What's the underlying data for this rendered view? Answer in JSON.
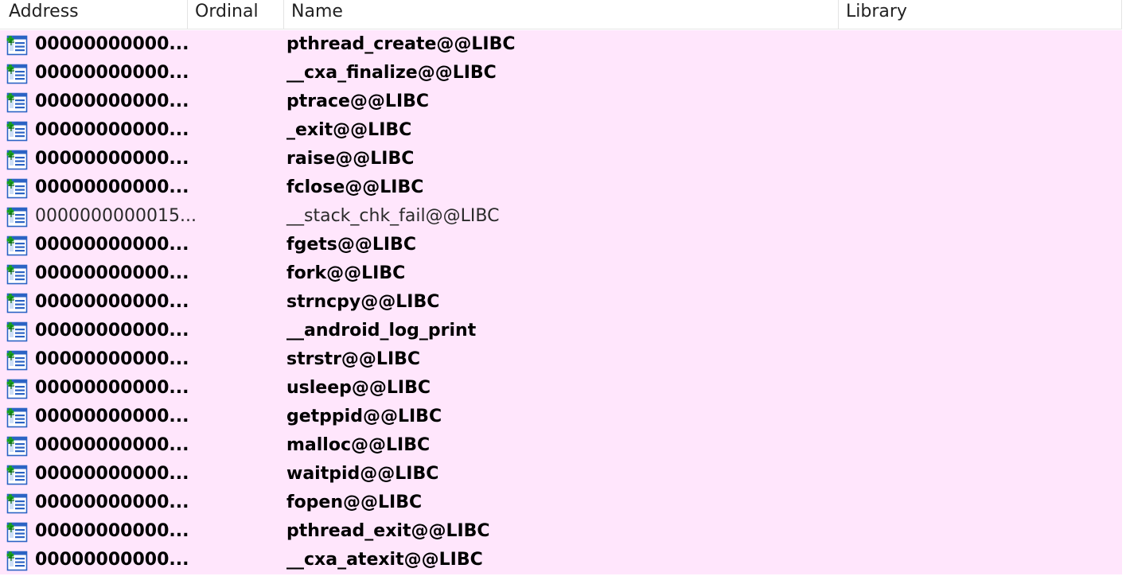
{
  "columns": {
    "address": "Address",
    "ordinal": "Ordinal",
    "name": "Name",
    "library": "Library"
  },
  "rows": [
    {
      "address": "00000000000...",
      "ordinal": "",
      "name": "pthread_create@@LIBC",
      "library": "",
      "bold": true
    },
    {
      "address": "00000000000...",
      "ordinal": "",
      "name": "__cxa_finalize@@LIBC",
      "library": "",
      "bold": true
    },
    {
      "address": "00000000000...",
      "ordinal": "",
      "name": "ptrace@@LIBC",
      "library": "",
      "bold": true
    },
    {
      "address": "00000000000...",
      "ordinal": "",
      "name": "_exit@@LIBC",
      "library": "",
      "bold": true
    },
    {
      "address": "00000000000...",
      "ordinal": "",
      "name": "raise@@LIBC",
      "library": "",
      "bold": true
    },
    {
      "address": "00000000000...",
      "ordinal": "",
      "name": "fclose@@LIBC",
      "library": "",
      "bold": true
    },
    {
      "address": "0000000000015...",
      "ordinal": "",
      "name": "__stack_chk_fail@@LIBC",
      "library": "",
      "bold": false
    },
    {
      "address": "00000000000...",
      "ordinal": "",
      "name": "fgets@@LIBC",
      "library": "",
      "bold": true
    },
    {
      "address": "00000000000...",
      "ordinal": "",
      "name": "fork@@LIBC",
      "library": "",
      "bold": true
    },
    {
      "address": "00000000000...",
      "ordinal": "",
      "name": "strncpy@@LIBC",
      "library": "",
      "bold": true
    },
    {
      "address": "00000000000...",
      "ordinal": "",
      "name": "__android_log_print",
      "library": "",
      "bold": true
    },
    {
      "address": "00000000000...",
      "ordinal": "",
      "name": "strstr@@LIBC",
      "library": "",
      "bold": true
    },
    {
      "address": "00000000000...",
      "ordinal": "",
      "name": "usleep@@LIBC",
      "library": "",
      "bold": true
    },
    {
      "address": "00000000000...",
      "ordinal": "",
      "name": "getppid@@LIBC",
      "library": "",
      "bold": true
    },
    {
      "address": "00000000000...",
      "ordinal": "",
      "name": "malloc@@LIBC",
      "library": "",
      "bold": true
    },
    {
      "address": "00000000000...",
      "ordinal": "",
      "name": "waitpid@@LIBC",
      "library": "",
      "bold": true
    },
    {
      "address": "00000000000...",
      "ordinal": "",
      "name": "fopen@@LIBC",
      "library": "",
      "bold": true
    },
    {
      "address": "00000000000...",
      "ordinal": "",
      "name": "pthread_exit@@LIBC",
      "library": "",
      "bold": true
    },
    {
      "address": "00000000000...",
      "ordinal": "",
      "name": "__cxa_atexit@@LIBC",
      "library": "",
      "bold": true
    }
  ],
  "row_icon": "import-function-icon",
  "colors": {
    "row_background": "#ffe6fc",
    "header_background": "#ffffff",
    "icon_blue": "#2b63c4",
    "icon_green": "#17a01f"
  }
}
